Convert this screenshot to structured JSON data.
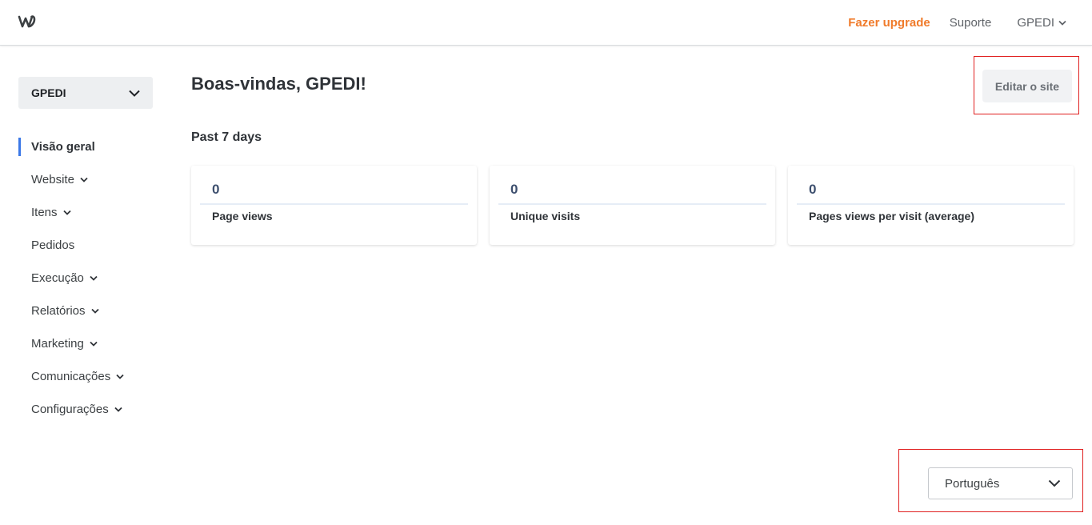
{
  "topbar": {
    "logo_icon": "weebly-w-icon",
    "upgrade_label": "Fazer upgrade",
    "support_label": "Suporte",
    "account_label": "GPEDI",
    "upgrade_color": "#f07b2b"
  },
  "site_selector": {
    "label": "GPEDI"
  },
  "sidebar": {
    "items": [
      {
        "label": "Visão geral",
        "active": true,
        "has_chevron": false
      },
      {
        "label": "Website",
        "has_chevron": true
      },
      {
        "label": "Itens",
        "has_chevron": true
      },
      {
        "label": "Pedidos",
        "has_chevron": false
      },
      {
        "label": "Execução",
        "has_chevron": true
      },
      {
        "label": "Relatórios",
        "has_chevron": true
      },
      {
        "label": "Marketing",
        "has_chevron": true
      },
      {
        "label": "Comunicações",
        "has_chevron": true
      },
      {
        "label": "Configurações",
        "has_chevron": true
      }
    ],
    "active_color": "#3b78e7"
  },
  "main": {
    "welcome": "Boas-vindas, GPEDI!",
    "edit_site_label": "Editar o site",
    "period_label": "Past 7 days",
    "stats": [
      {
        "value": "0",
        "label": "Page views"
      },
      {
        "value": "0",
        "label": "Unique visits"
      },
      {
        "value": "0",
        "label": "Pages views per visit (average)"
      }
    ]
  },
  "footer": {
    "language": "Português"
  },
  "highlight_color": "#e02020"
}
